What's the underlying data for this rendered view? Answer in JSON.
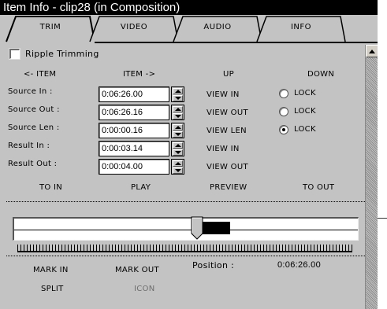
{
  "window": {
    "title": "Item Info - clip28 (in Composition)"
  },
  "tabs": [
    {
      "label": "TRIM"
    },
    {
      "label": "VIDEO"
    },
    {
      "label": "AUDIO"
    },
    {
      "label": "INFO"
    }
  ],
  "ripple": {
    "label": "Ripple Trimming",
    "checked": false
  },
  "headers": {
    "item_left": "<- ITEM",
    "item_right": "ITEM ->",
    "up": "UP",
    "down": "DOWN"
  },
  "rows": [
    {
      "label": "Source In :",
      "value": "0:06:26.00",
      "view": "VIEW IN",
      "lock": "LOCK"
    },
    {
      "label": "Source Out :",
      "value": "0:06:26.16",
      "view": "VIEW OUT",
      "lock": "LOCK"
    },
    {
      "label": "Source Len :",
      "value": "0:00:00.16",
      "view": "VIEW LEN",
      "lock": "LOCK"
    },
    {
      "label": "Result In :",
      "value": "0:00:03.14",
      "view": "VIEW IN"
    },
    {
      "label": "Result Out :",
      "value": "0:00:04.00",
      "view": "VIEW OUT"
    }
  ],
  "lock_selected": "Source Len",
  "transport": {
    "to_in": "TO IN",
    "play": "PLAY",
    "preview": "PREVIEW",
    "to_out": "TO OUT"
  },
  "bottom": {
    "mark_in": "MARK IN",
    "mark_out": "MARK OUT",
    "position_label": "Position :",
    "position_value": "0:06:26.00",
    "split": "SPLIT",
    "icon": "ICON"
  }
}
